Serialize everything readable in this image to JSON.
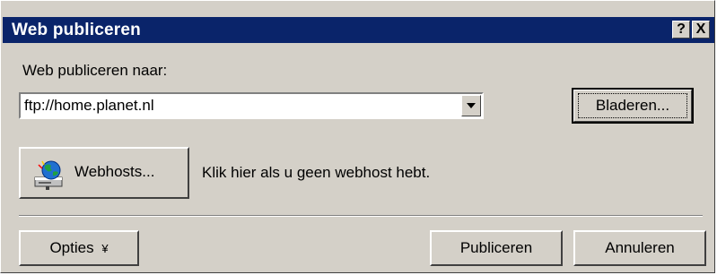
{
  "window": {
    "title": "Web publiceren",
    "help_button": "?",
    "close_button": "X"
  },
  "publish_to": {
    "label": "Web publiceren naar:",
    "value": "ftp://home.planet.nl"
  },
  "buttons": {
    "browse": "Bladeren...",
    "webhosts": "Webhosts...",
    "options": "Opties",
    "options_arrow": "¥",
    "publish": "Publiceren",
    "cancel": "Annuleren"
  },
  "webhost_hint": "Klik hier als u geen webhost hebt.",
  "icons": {
    "webhosts": "globe-computer-icon",
    "options_arrow": "double-chevron-down-icon",
    "combo_arrow": "dropdown-arrow-icon"
  },
  "colors": {
    "titlebar": "#0a246a",
    "face": "#d4d0c8"
  }
}
